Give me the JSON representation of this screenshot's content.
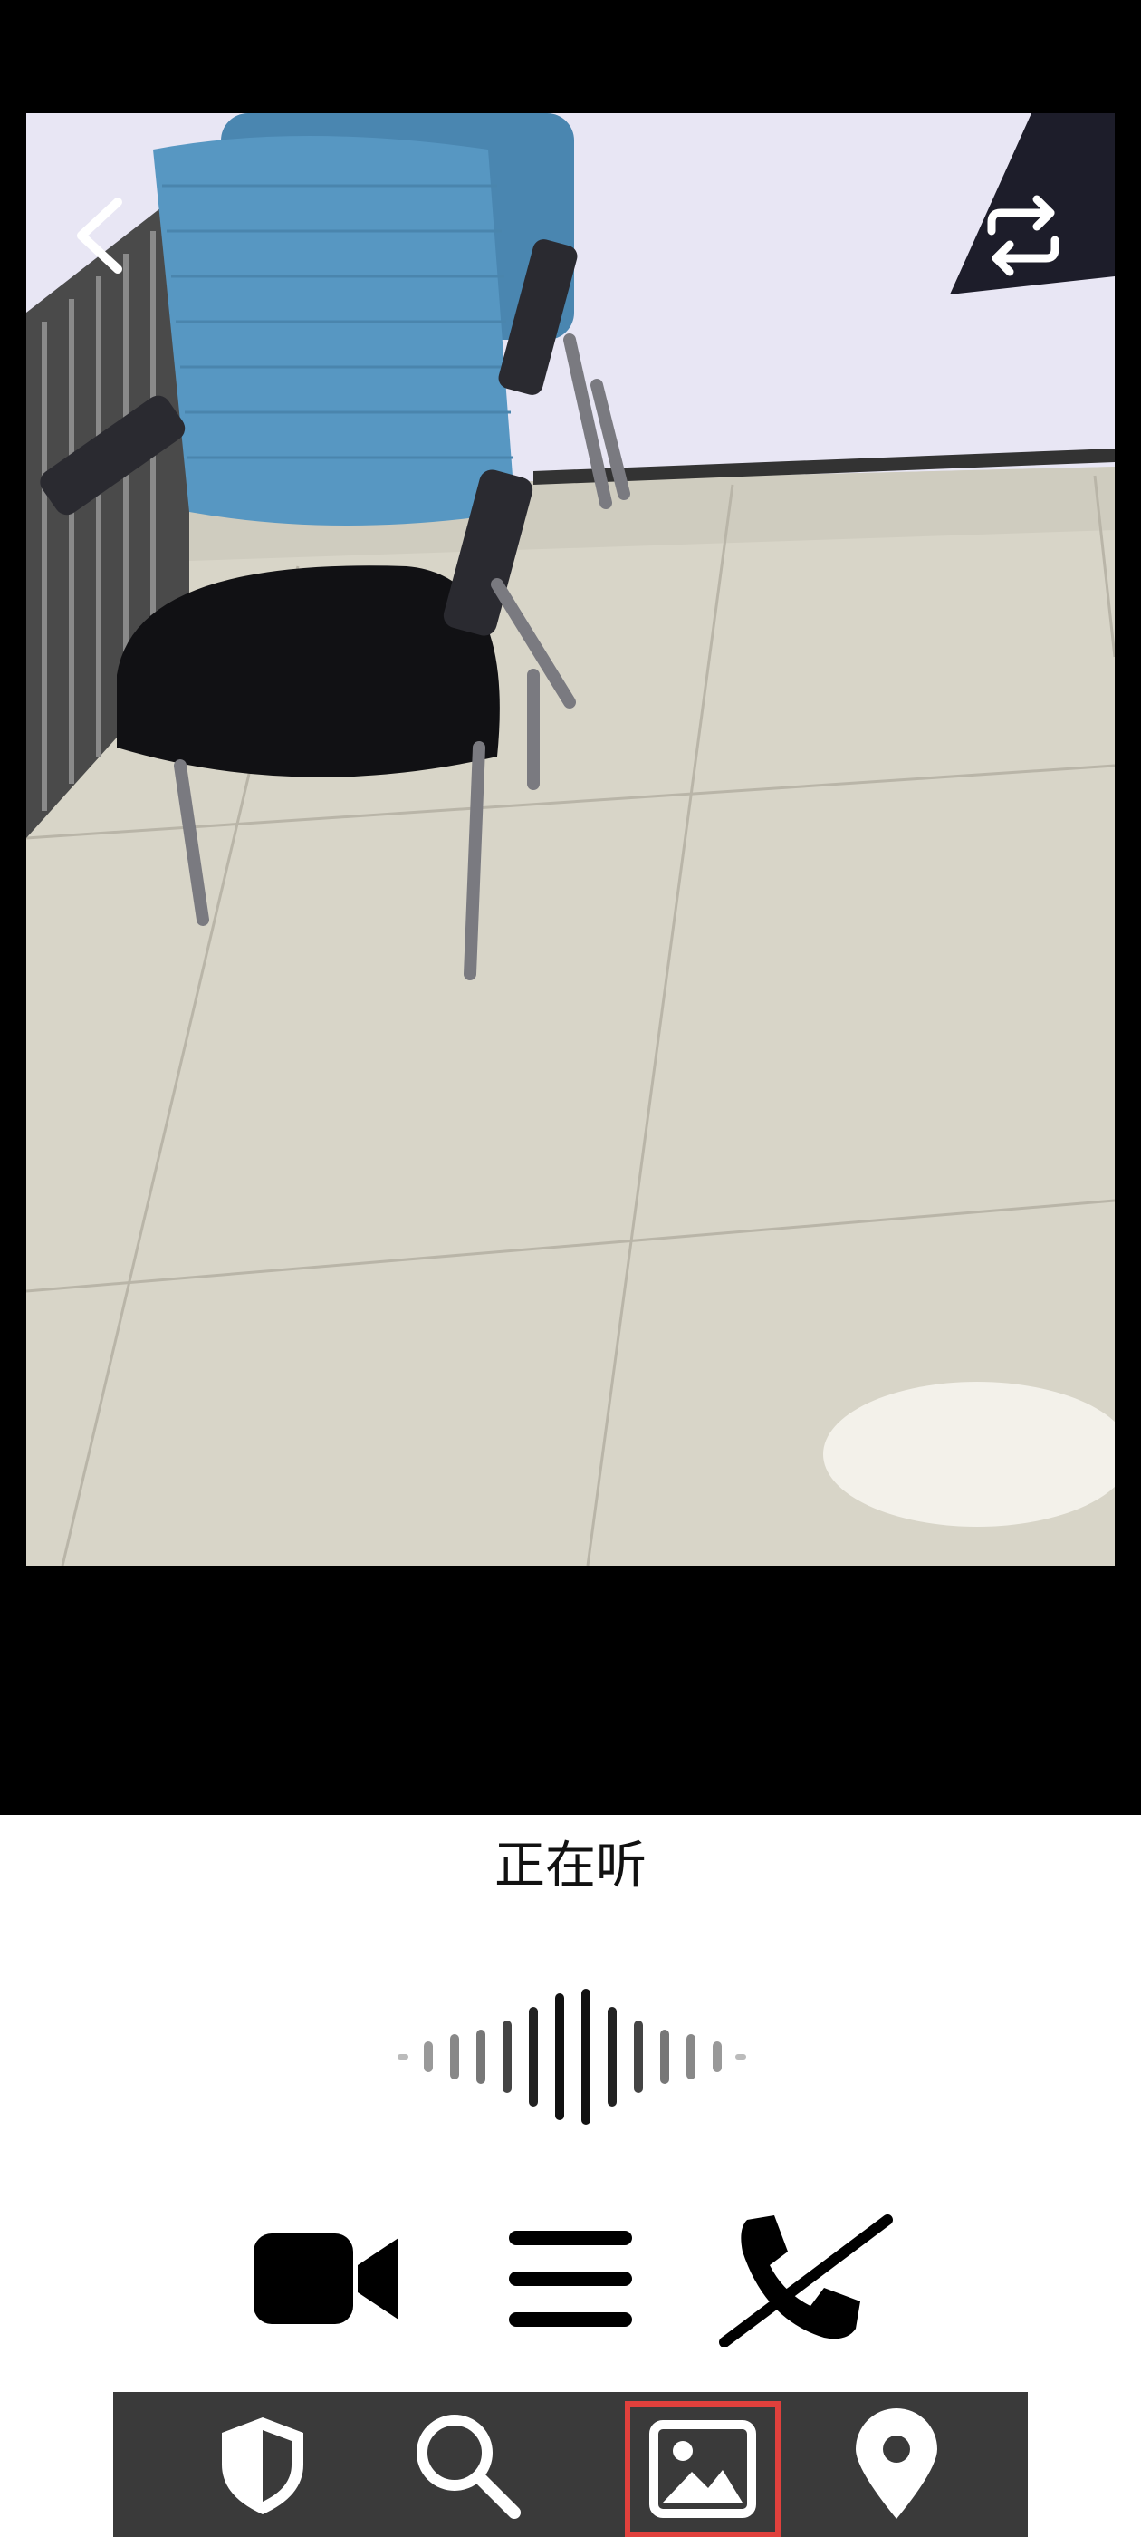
{
  "header": {
    "back_icon": "chevron-left-icon",
    "switch_camera_icon": "switch-camera-icon"
  },
  "status": {
    "listening_text": "正在听"
  },
  "controls": {
    "video_icon": "video-camera-icon",
    "menu_icon": "menu-icon",
    "hangup_icon": "phone-off-icon"
  },
  "bottom_nav": {
    "items": [
      {
        "icon": "shield-icon",
        "selected": false
      },
      {
        "icon": "search-icon",
        "selected": false
      },
      {
        "icon": "image-icon",
        "selected": true
      },
      {
        "icon": "location-pin-icon",
        "selected": false
      }
    ],
    "highlight_color": "#e0403c"
  }
}
